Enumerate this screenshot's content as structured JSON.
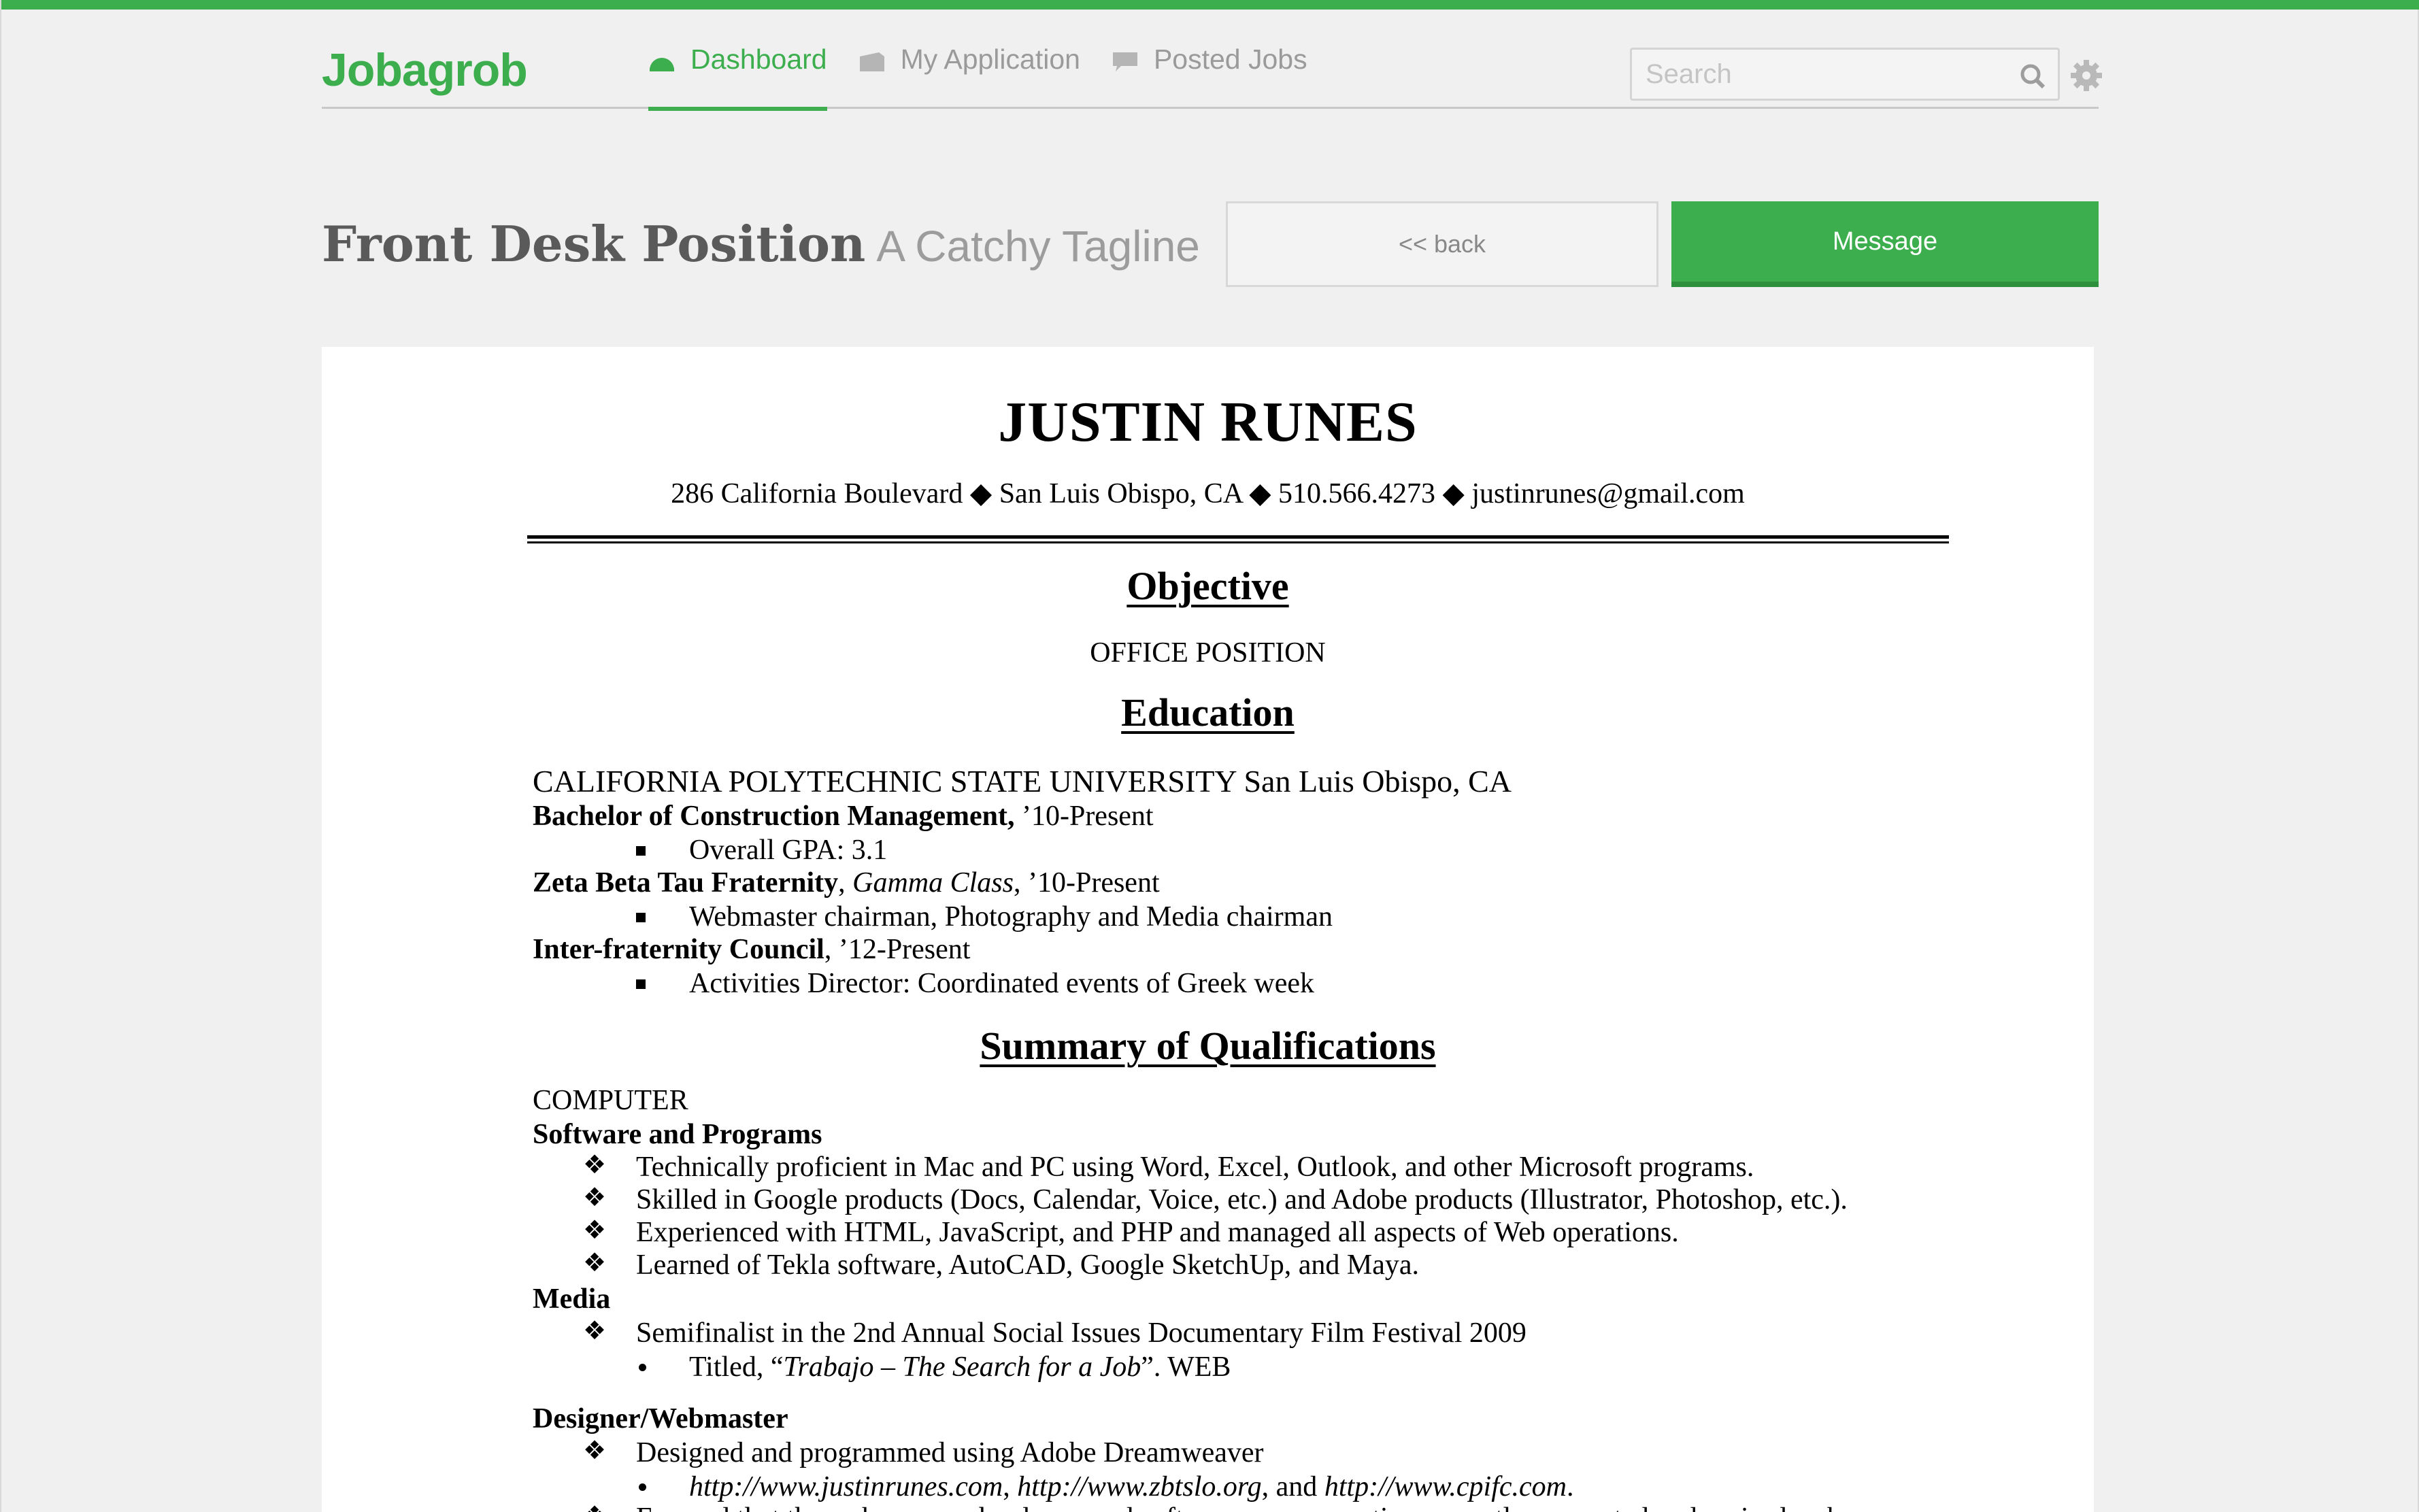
{
  "app": {
    "logo": "Jobagrob",
    "accent": "#3cae4d"
  },
  "nav": [
    {
      "label": "Dashboard",
      "icon": "dashboard-icon",
      "active": true
    },
    {
      "label": "My Application",
      "icon": "application-icon",
      "active": false
    },
    {
      "label": "Posted Jobs",
      "icon": "chat-icon",
      "active": false
    }
  ],
  "search": {
    "placeholder": "Search",
    "value": ""
  },
  "page": {
    "title": "Front Desk Position",
    "tagline": "A Catchy Tagline",
    "back_label": "<< back",
    "message_label": "Message"
  },
  "resume": {
    "name": "JUSTIN RUNES",
    "contact": "286 California Boulevard ◆ San Luis Obispo, CA ◆ 510.566.4273 ◆ justinrunes@gmail.com",
    "objective_heading": "Objective",
    "objective": "OFFICE POSITION",
    "education_heading": "Education",
    "university": "CALIFORNIA POLYTECHNIC STATE UNIVERSITY San Luis Obispo, CA",
    "degree": "Bachelor of Construction Management,",
    "degree_years": " ’10-Present",
    "gpa": "Overall GPA: 3.1",
    "fraternity": "Zeta Beta Tau Fraternity",
    "fraternity_class": "Gamma Class",
    "fraternity_years": ", ’10-Present",
    "fraternity_role": "Webmaster chairman, Photography and Media chairman",
    "council": "Inter-fraternity Council",
    "council_years": ", ’12-Present",
    "council_role": "Activities Director: Coordinated events of Greek week",
    "qualifications_heading": "Summary of Qualifications",
    "computer_label": "COMPUTER",
    "software_label": "Software and Programs",
    "software_items": [
      "Technically proficient in Mac and PC using Word, Excel, Outlook, and other Microsoft programs.",
      "Skilled in Google products (Docs, Calendar, Voice, etc.) and Adobe products (Illustrator, Photoshop, etc.).",
      "Experienced with HTML, JavaScript, and PHP and managed all aspects of Web operations.",
      "Learned of Tekla software, AutoCAD, Google SketchUp, and Maya."
    ],
    "media_label": "Media",
    "media_item": "Semifinalist in the 2nd Annual Social Issues Documentary Film Festival 2009",
    "media_sub_prefix": "Titled, “",
    "media_sub_title": "Trabajo – The Search for a Job",
    "media_sub_suffix": "”. WEB",
    "designer_label": "Designer/Webmaster",
    "designer_item": "Designed and programmed using Adobe Dreamweaver",
    "designer_url1": "http://www.justinrunes.com",
    "designer_url2": "http://www.zbtslo.org",
    "designer_url3": "http://www.cpifc.com",
    "designer_item2": "Ensured that the web servers, hardware and software were operating correctly, generated and revised web"
  }
}
